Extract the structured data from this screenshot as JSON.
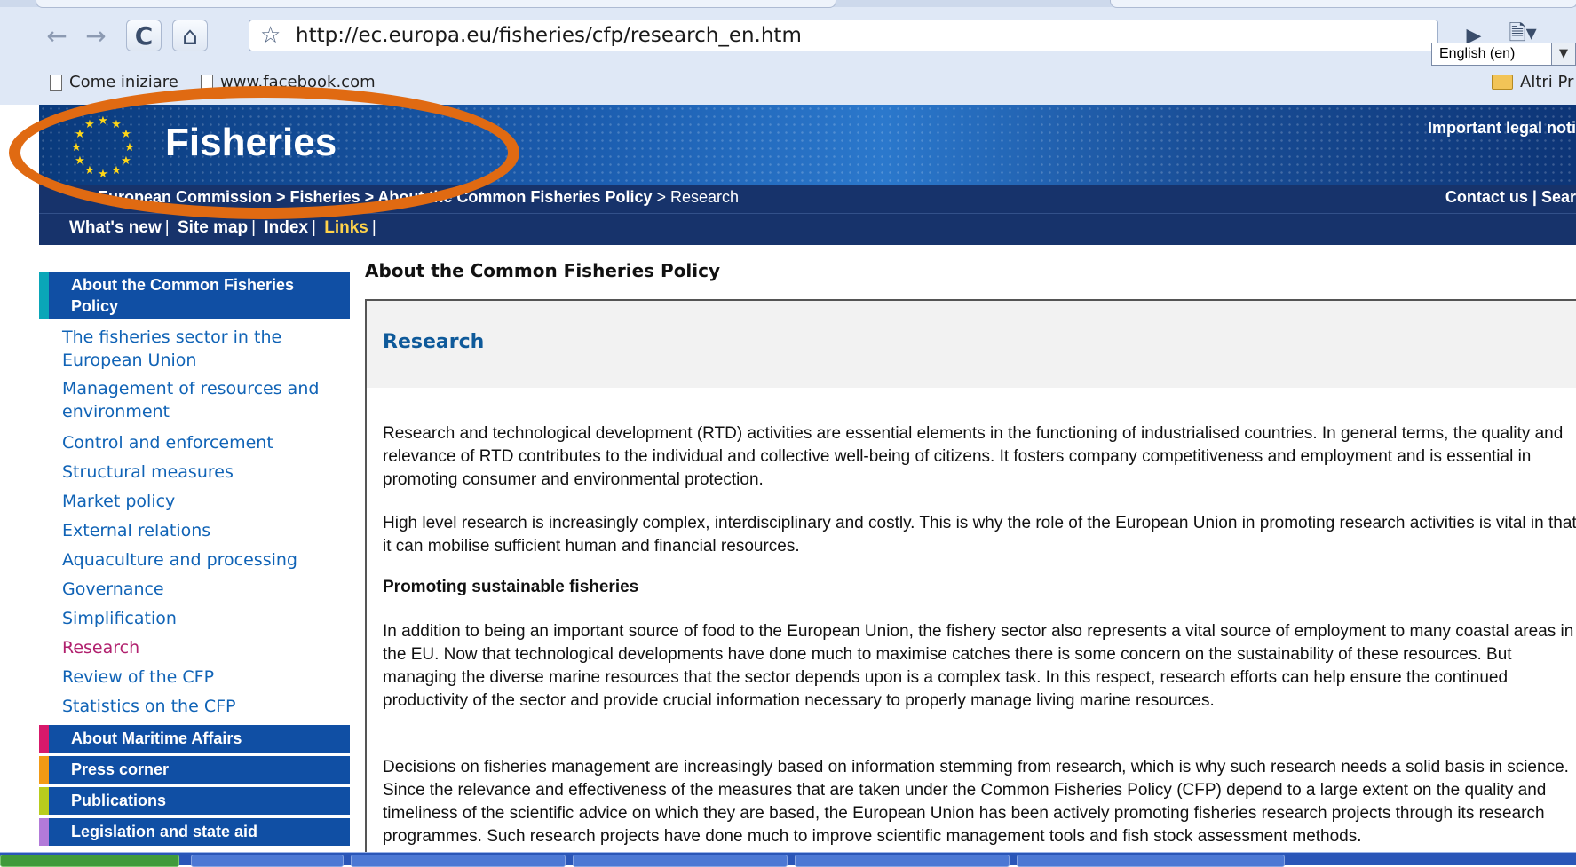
{
  "browser": {
    "url": "http://ec.europa.eu/fisheries/cfp/research_en.htm",
    "bookmarks": [
      {
        "label": "Come iniziare"
      },
      {
        "label": "www.facebook.com"
      }
    ],
    "other_bookmarks": "Altri Pr",
    "icons": [
      "back-icon",
      "forward-icon",
      "reload-icon",
      "home-icon",
      "star-icon",
      "play-icon",
      "page-menu-icon"
    ]
  },
  "header": {
    "site_title": "Fisheries",
    "legal_notice": "Important legal noti",
    "language": "English (en)",
    "breadcrumb_bold": "European Commission > Fisheries > About the Common Fisheries Policy",
    "breadcrumb_current": "> Research",
    "top_links": "Contact us | Sear",
    "util_links": [
      "What's new",
      "Site map",
      "Index",
      "Links"
    ]
  },
  "sidebar": {
    "section_title": "About the Common Fisheries Policy",
    "items": [
      {
        "label": "The fisheries sector in the European Union"
      },
      {
        "label": "Management of resources and environment"
      },
      {
        "label": "Control and enforcement"
      },
      {
        "label": "Structural measures"
      },
      {
        "label": "Market policy"
      },
      {
        "label": "External relations"
      },
      {
        "label": "Aquaculture and processing"
      },
      {
        "label": "Governance"
      },
      {
        "label": "Simplification"
      },
      {
        "label": "Research"
      },
      {
        "label": "Review of the CFP"
      },
      {
        "label": "Statistics on the CFP"
      }
    ],
    "current": "Research",
    "sections": [
      {
        "label": "About Maritime Affairs",
        "color": "#d7196b"
      },
      {
        "label": "Press corner",
        "color": "#f29a14"
      },
      {
        "label": "Publications",
        "color": "#b8cc1d"
      },
      {
        "label": "Legislation and state aid",
        "color": "#b27ad9"
      }
    ]
  },
  "main": {
    "page_heading": "About the Common Fisheries Policy",
    "title": "Research",
    "paragraphs": [
      "Research and technological development (RTD) activities are essential elements in the functioning of industrialised countries. In general terms, the quality and relevance of RTD contributes to the individual and collective well-being of citizens. It fosters company competitiveness and employment and is essential in promoting consumer and environmental protection.",
      "High level research is increasingly complex, interdisciplinary and costly. This is why the role of the European Union in promoting research activities is vital in that it can mobilise sufficient human and financial resources."
    ],
    "subheading": "Promoting sustainable fisheries",
    "paragraphs2": [
      "In addition to being an important source of food to the European Union, the fishery sector also represents a vital source of employment to many coastal areas in the EU. Now that technological developments have done much to maximise catches there is some concern on the sustainability of these resources. But managing the diverse marine resources that the sector depends upon is a complex task. In this respect, research efforts can help ensure the continued productivity of the sector and provide crucial information necessary to properly manage living marine resources.",
      "Decisions on fisheries management are increasingly based on information stemming from research, which is why such research needs a solid basis in science. Since the relevance and effectiveness of the measures that are taken under the Common Fisheries Policy (CFP) depend to a large extent on the quality and timeliness of the scientific advice on which they are based, the European Union has been actively promoting fisheries research projects through its research programmes. Such research projects have done much to improve scientific management tools and fish stock assessment methods."
    ]
  },
  "colors": {
    "accent_orange": "#e06a12",
    "nav_blue": "#104fa4",
    "link_blue": "#1063b6",
    "current_magenta": "#b1206e",
    "banner_dark": "#17336b"
  }
}
